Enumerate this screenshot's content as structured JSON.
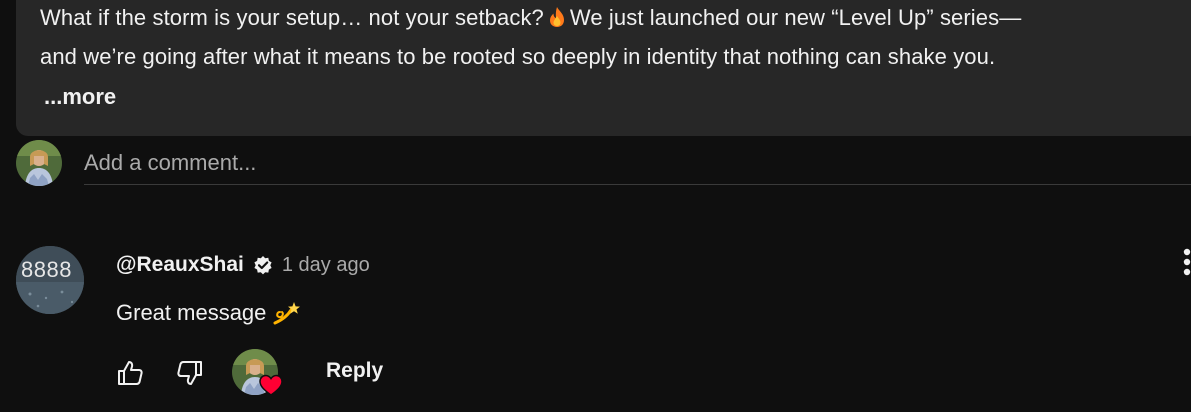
{
  "description": {
    "line1_a": "What if the storm is your setup… not your setback?",
    "line1_b": "We just launched our new “Level Up” series—",
    "line2": "and we’re going after what it means to be rooted so deeply in identity that nothing can shake you.",
    "more_label": "...more",
    "emoji_icon": "fire-icon"
  },
  "add_comment": {
    "placeholder": "Add a comment..."
  },
  "comment": {
    "author": "@ReauxShai",
    "timestamp": "1 day ago",
    "text": "Great message",
    "emoji_icon": "dizzy-icon",
    "avatar_text": "8888",
    "reply_label": "Reply"
  },
  "colors": {
    "background": "#0f0f0f",
    "description_bg": "#272727",
    "text_primary": "#f1f1f1",
    "text_secondary": "#aaaaaa",
    "heart": "#ff0033"
  }
}
